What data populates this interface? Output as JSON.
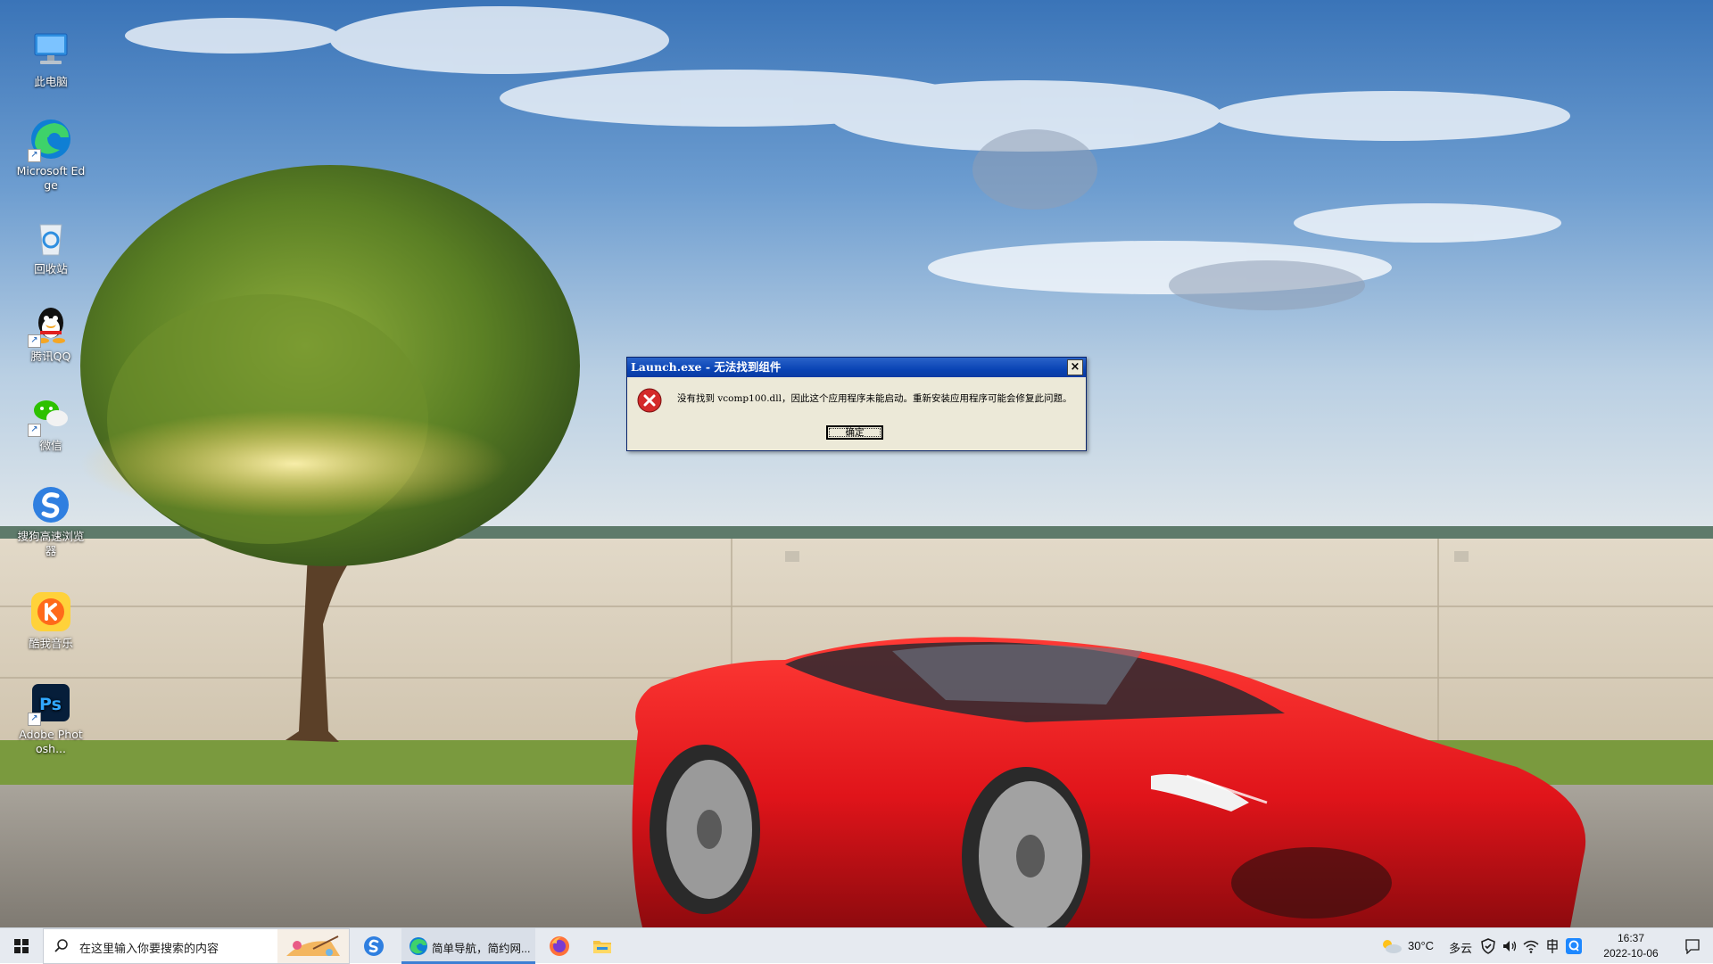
{
  "desktop": {
    "icons": [
      {
        "name": "此电脑",
        "icon": "computer-icon"
      },
      {
        "name": "Microsoft Edge",
        "icon": "edge-icon"
      },
      {
        "name": "回收站",
        "icon": "recycle-bin-icon"
      },
      {
        "name": "腾讯QQ",
        "icon": "qq-icon"
      },
      {
        "name": "微信",
        "icon": "wechat-icon"
      },
      {
        "name": "搜狗高速浏览器",
        "icon": "sogou-browser-icon"
      },
      {
        "name": "酷我音乐",
        "icon": "kuwo-music-icon"
      },
      {
        "name": "Adobe Photosh...",
        "icon": "photoshop-icon"
      }
    ]
  },
  "dialog": {
    "title": "Launch.exe - 无法找到组件",
    "message": "没有找到 vcomp100.dll，因此这个应用程序未能启动。重新安装应用程序可能会修复此问题。",
    "ok_label": "确定",
    "close_label": "×",
    "icon": "error-icon"
  },
  "taskbar": {
    "search_placeholder": "在这里输入你要搜索的内容",
    "apps": [
      {
        "name": "sogou-browser",
        "icon": "sogou-browser-icon"
      },
      {
        "name": "edge",
        "icon": "edge-icon",
        "label": "简单导航，简约网...",
        "active": true
      },
      {
        "name": "firefox",
        "icon": "firefox-icon"
      },
      {
        "name": "file-explorer",
        "icon": "folder-icon"
      }
    ],
    "weather": {
      "temp": "30°C",
      "condition": "多云"
    },
    "tray_icons": [
      "security-shield-icon",
      "volume-icon",
      "wifi-icon",
      "ime-icon",
      "qq-tray-icon"
    ],
    "clock": {
      "time": "16:37",
      "date": "2022-10-06"
    }
  },
  "colors": {
    "accent": "#3c7fd4",
    "dialog_title": "#0a44b5",
    "dialog_body": "#ece9d8",
    "car_red": "#e0141a"
  }
}
